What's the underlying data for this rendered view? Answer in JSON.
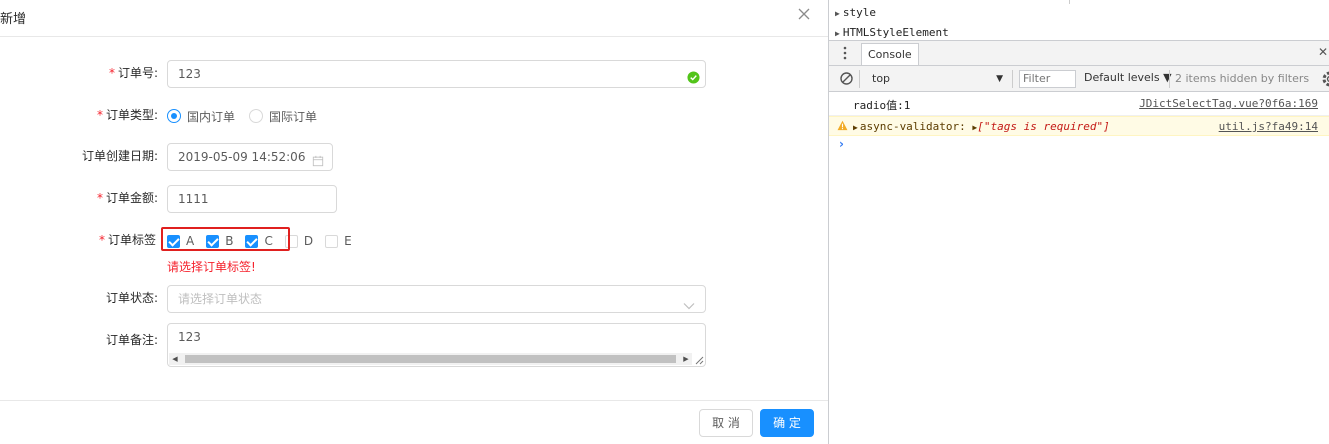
{
  "modal": {
    "title": "新增",
    "fields": {
      "order_no": {
        "label": "订单号:",
        "value": "123"
      },
      "order_type": {
        "label": "订单类型:",
        "options": [
          {
            "label": "国内订单",
            "checked": true
          },
          {
            "label": "国际订单",
            "checked": false
          }
        ]
      },
      "created_at": {
        "label": "订单创建日期:",
        "value": "2019-05-09 14:52:06"
      },
      "amount": {
        "label": "订单金额:",
        "value": "1111"
      },
      "tags": {
        "label": "订单标签",
        "options": [
          {
            "label": "A",
            "checked": true
          },
          {
            "label": "B",
            "checked": true
          },
          {
            "label": "C",
            "checked": true
          },
          {
            "label": "D",
            "checked": false
          },
          {
            "label": "E",
            "checked": false
          }
        ],
        "error": "请选择订单标签!"
      },
      "status": {
        "label": "订单状态:",
        "placeholder": "请选择订单状态"
      },
      "remark": {
        "label": "订单备注:",
        "value": "123"
      }
    },
    "footer": {
      "cancel_label": "取 消",
      "ok_label": "确 定"
    }
  },
  "devtools": {
    "elements": [
      "style",
      "HTMLStyleElement"
    ],
    "tabs": {
      "console": "Console"
    },
    "toolbar": {
      "context": "top",
      "filter_placeholder": "Filter",
      "levels": "Default levels ▼",
      "hidden_info": "2 items hidden by filters"
    },
    "messages": {
      "log": {
        "text": "radio值:1",
        "source": "JDictSelectTag.vue?0f6a:169"
      },
      "warn": {
        "prefix": "async-validator:",
        "payload": "[\"tags is required\"]",
        "source": "util.js?fa49:14"
      }
    },
    "prompt": "›"
  },
  "colors": {
    "primary": "#1890ff",
    "error": "#f5222d",
    "success": "#52c41a",
    "highlight": "#e0201f",
    "warn_bg": "#fffbe5"
  }
}
